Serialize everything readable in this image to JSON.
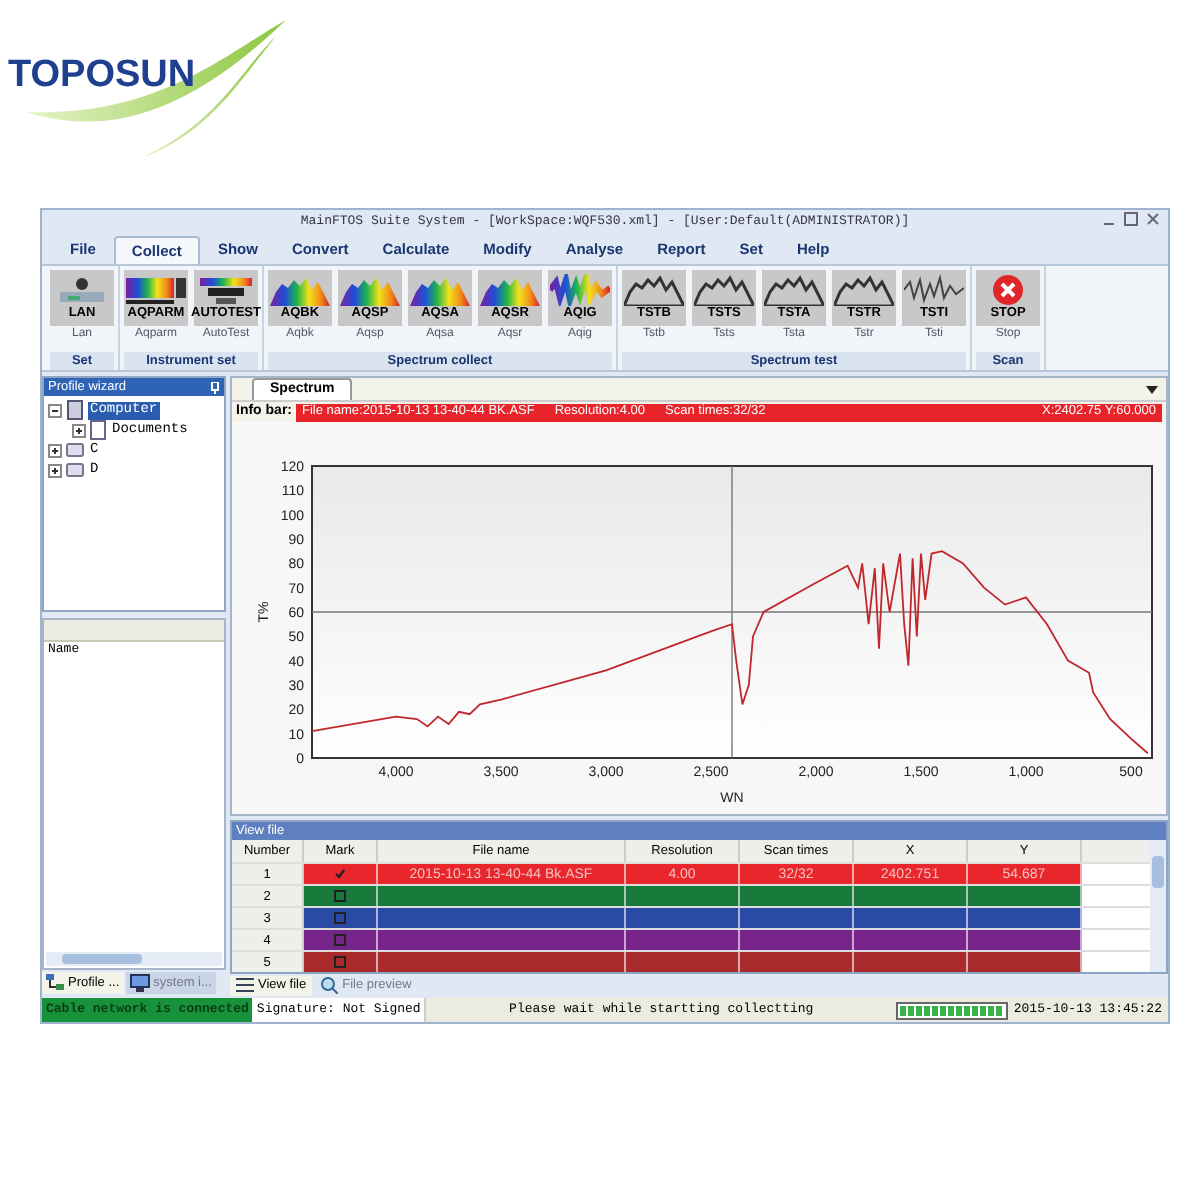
{
  "brand": {
    "name": "TOPOSUN"
  },
  "window": {
    "title": "MainFTOS Suite System - [WorkSpace:WQF530.xml] - [User:Default(ADMINISTRATOR)]"
  },
  "menu": [
    {
      "label": "File",
      "selected": false
    },
    {
      "label": "Collect",
      "selected": true
    },
    {
      "label": "Show",
      "selected": false
    },
    {
      "label": "Convert",
      "selected": false
    },
    {
      "label": "Calculate",
      "selected": false
    },
    {
      "label": "Modify",
      "selected": false
    },
    {
      "label": "Analyse",
      "selected": false
    },
    {
      "label": "Report",
      "selected": false
    },
    {
      "label": "Set",
      "selected": false
    },
    {
      "label": "Help",
      "selected": false
    }
  ],
  "ribbon": [
    {
      "label": "Set",
      "buttons": [
        {
          "caption": "LAN",
          "label": "Lan",
          "kind": "network"
        }
      ]
    },
    {
      "label": "Instrument set",
      "buttons": [
        {
          "caption": "AQPARM",
          "label": "Aqparm",
          "kind": "colorbar"
        },
        {
          "caption": "AUTOTEST",
          "label": "AutoTest",
          "kind": "device"
        }
      ]
    },
    {
      "label": "Spectrum collect",
      "buttons": [
        {
          "caption": "AQBK",
          "label": "Aqbk",
          "kind": "spectrum"
        },
        {
          "caption": "AQSP",
          "label": "Aqsp",
          "kind": "spectrum"
        },
        {
          "caption": "AQSA",
          "label": "Aqsa",
          "kind": "spectrum"
        },
        {
          "caption": "AQSR",
          "label": "Aqsr",
          "kind": "spectrum"
        },
        {
          "caption": "AQIG",
          "label": "Aqig",
          "kind": "noise"
        }
      ]
    },
    {
      "label": "Spectrum test",
      "buttons": [
        {
          "caption": "TSTB",
          "label": "Tstb",
          "kind": "test"
        },
        {
          "caption": "TSTS",
          "label": "Tsts",
          "kind": "test"
        },
        {
          "caption": "TSTA",
          "label": "Tsta",
          "kind": "test"
        },
        {
          "caption": "TSTR",
          "label": "Tstr",
          "kind": "test"
        },
        {
          "caption": "TSTI",
          "label": "Tsti",
          "kind": "testnoise"
        }
      ]
    },
    {
      "label": "Scan",
      "buttons": [
        {
          "caption": "STOP",
          "label": "Stop",
          "kind": "stop"
        }
      ]
    }
  ],
  "profile_wizard": {
    "title": "Profile wizard",
    "tree": [
      {
        "label": "Computer",
        "kind": "computer",
        "expanded": true,
        "selected": true,
        "children": [
          {
            "label": "Documents",
            "kind": "document",
            "expanded": false,
            "selected": false
          }
        ]
      },
      {
        "label": "C",
        "kind": "drive",
        "expanded": false,
        "selected": false
      },
      {
        "label": "D",
        "kind": "drive",
        "expanded": false,
        "selected": false
      }
    ]
  },
  "name_panel": {
    "header": "Name"
  },
  "left_tabs": [
    {
      "label": "Profile ...",
      "kind": "tree",
      "selected": true
    },
    {
      "label": "system i...",
      "kind": "monitor",
      "selected": false
    }
  ],
  "document_tabs": [
    {
      "label": "Spectrum",
      "selected": true
    }
  ],
  "info_bar": {
    "label": "Info bar:",
    "file": "File name:2015-10-13 13-40-44 BK.ASF",
    "resolution": "Resolution:4.00",
    "scan_times": "Scan times:32/32",
    "cursor": "X:2402.75 Y:60.000"
  },
  "spectrum": {
    "chart_data": {
      "type": "line",
      "xlabel": "WN",
      "ylabel": "T%",
      "xlim": [
        4400,
        400
      ],
      "ylim": [
        0,
        120
      ],
      "xticks": [
        {
          "value": 4000,
          "label": "4,000"
        },
        {
          "value": 3500,
          "label": "3,500"
        },
        {
          "value": 3000,
          "label": "3,000"
        },
        {
          "value": 2500,
          "label": "2,500"
        },
        {
          "value": 2000,
          "label": "2,000"
        },
        {
          "value": 1500,
          "label": "1,500"
        },
        {
          "value": 1000,
          "label": "1,000"
        },
        {
          "value": 500,
          "label": "500"
        }
      ],
      "yticks": [
        0,
        10,
        20,
        30,
        40,
        50,
        60,
        70,
        80,
        90,
        100,
        110,
        120
      ],
      "x": [
        4400,
        4000,
        3900,
        3850,
        3800,
        3750,
        3700,
        3650,
        3600,
        3500,
        3000,
        2500,
        2400,
        2380,
        2350,
        2320,
        2300,
        2250,
        2000,
        1850,
        1800,
        1780,
        1750,
        1720,
        1700,
        1680,
        1650,
        1600,
        1580,
        1560,
        1540,
        1520,
        1500,
        1480,
        1450,
        1400,
        1300,
        1200,
        1100,
        1000,
        900,
        800,
        700,
        680,
        600,
        500,
        420
      ],
      "series": [
        {
          "color": "#c0272d",
          "values": [
            11,
            17,
            16,
            13,
            17,
            14,
            19,
            18,
            22,
            24,
            36,
            52,
            55,
            40,
            22,
            30,
            50,
            60,
            72,
            79,
            70,
            80,
            55,
            78,
            45,
            80,
            60,
            84,
            55,
            38,
            82,
            50,
            84,
            65,
            84,
            85,
            80,
            70,
            63,
            66,
            55,
            40,
            35,
            27,
            16,
            8,
            2
          ]
        }
      ],
      "ref_lines": [
        {
          "axis": "x",
          "value": 2400
        },
        {
          "axis": "y",
          "value": 60
        }
      ]
    }
  },
  "view_file": {
    "title": "View file",
    "columns": [
      "Number",
      "Mark",
      "File name",
      "Resolution",
      "Scan times",
      "X",
      "Y"
    ],
    "rows": [
      {
        "color": "#e8262b",
        "checked": true,
        "cells": [
          "1",
          "",
          "2015-10-13 13-40-44 Bk.ASF",
          "4.00",
          "32/32",
          "2402.751",
          "54.687"
        ]
      },
      {
        "color": "#17793a",
        "checked": false,
        "cells": [
          "2",
          "",
          "",
          "",
          "",
          "",
          ""
        ]
      },
      {
        "color": "#2b4aa6",
        "checked": false,
        "cells": [
          "3",
          "",
          "",
          "",
          "",
          "",
          ""
        ]
      },
      {
        "color": "#77258a",
        "checked": false,
        "cells": [
          "4",
          "",
          "",
          "",
          "",
          "",
          ""
        ]
      },
      {
        "color": "#a82a2a",
        "checked": false,
        "cells": [
          "5",
          "",
          "",
          "",
          "",
          "",
          ""
        ]
      }
    ]
  },
  "right_tabs": [
    {
      "label": "View file",
      "kind": "list",
      "selected": true
    },
    {
      "label": "File preview",
      "kind": "preview",
      "selected": false
    }
  ],
  "status_bar": {
    "connection": "Cable network is connected",
    "signature": "Signature: Not Signed",
    "message": "Please wait while startting collectting",
    "progress": {
      "level": 1
    },
    "time": "2015-10-13 13:45:22"
  }
}
